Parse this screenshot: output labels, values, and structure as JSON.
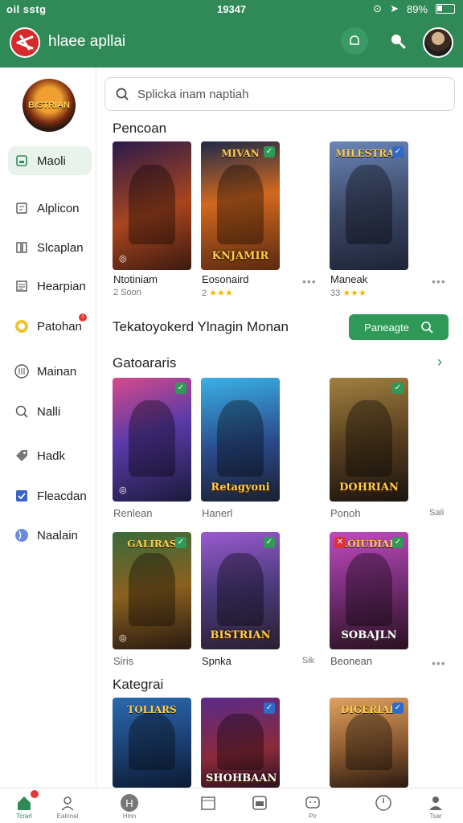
{
  "status_bar": {
    "left": "oil sstg",
    "time": "19347",
    "battery": "89%"
  },
  "header": {
    "title": "hlaee apllai"
  },
  "sidebar": {
    "brand_text": "BISTRIAN",
    "items": [
      {
        "label": "Maoli",
        "icon": "square-icon",
        "active": true
      },
      {
        "label": "Alplicon",
        "icon": "list-icon"
      },
      {
        "label": "Slcaplan",
        "icon": "columns-icon"
      },
      {
        "label": "Hearpian",
        "icon": "lines-icon"
      },
      {
        "label": "Patohan",
        "icon": "coin-icon",
        "badge": "!"
      },
      {
        "label": "Mainan",
        "icon": "circle-grid-icon"
      },
      {
        "label": "Nalli",
        "icon": "search-icon"
      },
      {
        "label": "Hadk",
        "icon": "tag-icon"
      },
      {
        "label": "Fleacdan",
        "icon": "shield-check-icon"
      },
      {
        "label": "Naalain",
        "icon": "globe-icon"
      }
    ]
  },
  "search": {
    "placeholder": "Splicka inam naptiah"
  },
  "sections": {
    "s1": "Pencoan",
    "s2": "Gatoararis",
    "s3": "Kategrai"
  },
  "row1": [
    {
      "label": "Ntotiniam",
      "sub": "2 Soon",
      "art_bottom": "",
      "art_top": ""
    },
    {
      "label": "Eosonaird",
      "sub": "2",
      "stars": "★★★",
      "art_top": "MIVAN",
      "art_bottom": "KNJAMIR"
    },
    {
      "label": "Maneak",
      "sub": "33",
      "stars": "★★★",
      "art_top": "MILESTRAK",
      "art_bottom": ""
    }
  ],
  "promo": {
    "text": "Tekatoyokerd Ylnagin Monan",
    "button": "Paneagte"
  },
  "row2": [
    {
      "label": "Renlean",
      "art_bottom": ""
    },
    {
      "label": "Hanerl",
      "art_bottom": "Retagyoni"
    },
    {
      "label": "Ponoh",
      "art_bottom": "DOHRIAN",
      "right": "Saii"
    }
  ],
  "row3": [
    {
      "label": "Siris",
      "art_top": "GALIRAS",
      "right": ""
    },
    {
      "label": "Spnka",
      "art_bottom": "BISTRIAN",
      "right": "Sik"
    },
    {
      "label": "Beonean",
      "art_top": "LOIUDIAR",
      "art_bottom": "SOBAJLN"
    }
  ],
  "row4": [
    {
      "art_top": "TOLIARS"
    },
    {
      "art_bottom": "SHOHBAAN"
    },
    {
      "art_top": "DIGERIAR"
    }
  ],
  "bottom_nav": [
    {
      "label": "Tcrarl",
      "icon": "home-icon"
    },
    {
      "label": "Ealrinal",
      "icon": "person-group-icon"
    },
    {
      "label": "Hlnn",
      "icon": "h-circle-icon"
    },
    {
      "label": "",
      "icon": "window-icon"
    },
    {
      "label": "",
      "icon": "box-icon"
    },
    {
      "label": "Pir",
      "icon": "chat-icon"
    },
    {
      "label": "",
      "icon": "gauge-icon"
    },
    {
      "label": "Tsar",
      "icon": "user-icon"
    }
  ],
  "colors": {
    "brand_green": "#2f8a58",
    "accent_green": "#2f9a58",
    "badge_red": "#e53935"
  }
}
